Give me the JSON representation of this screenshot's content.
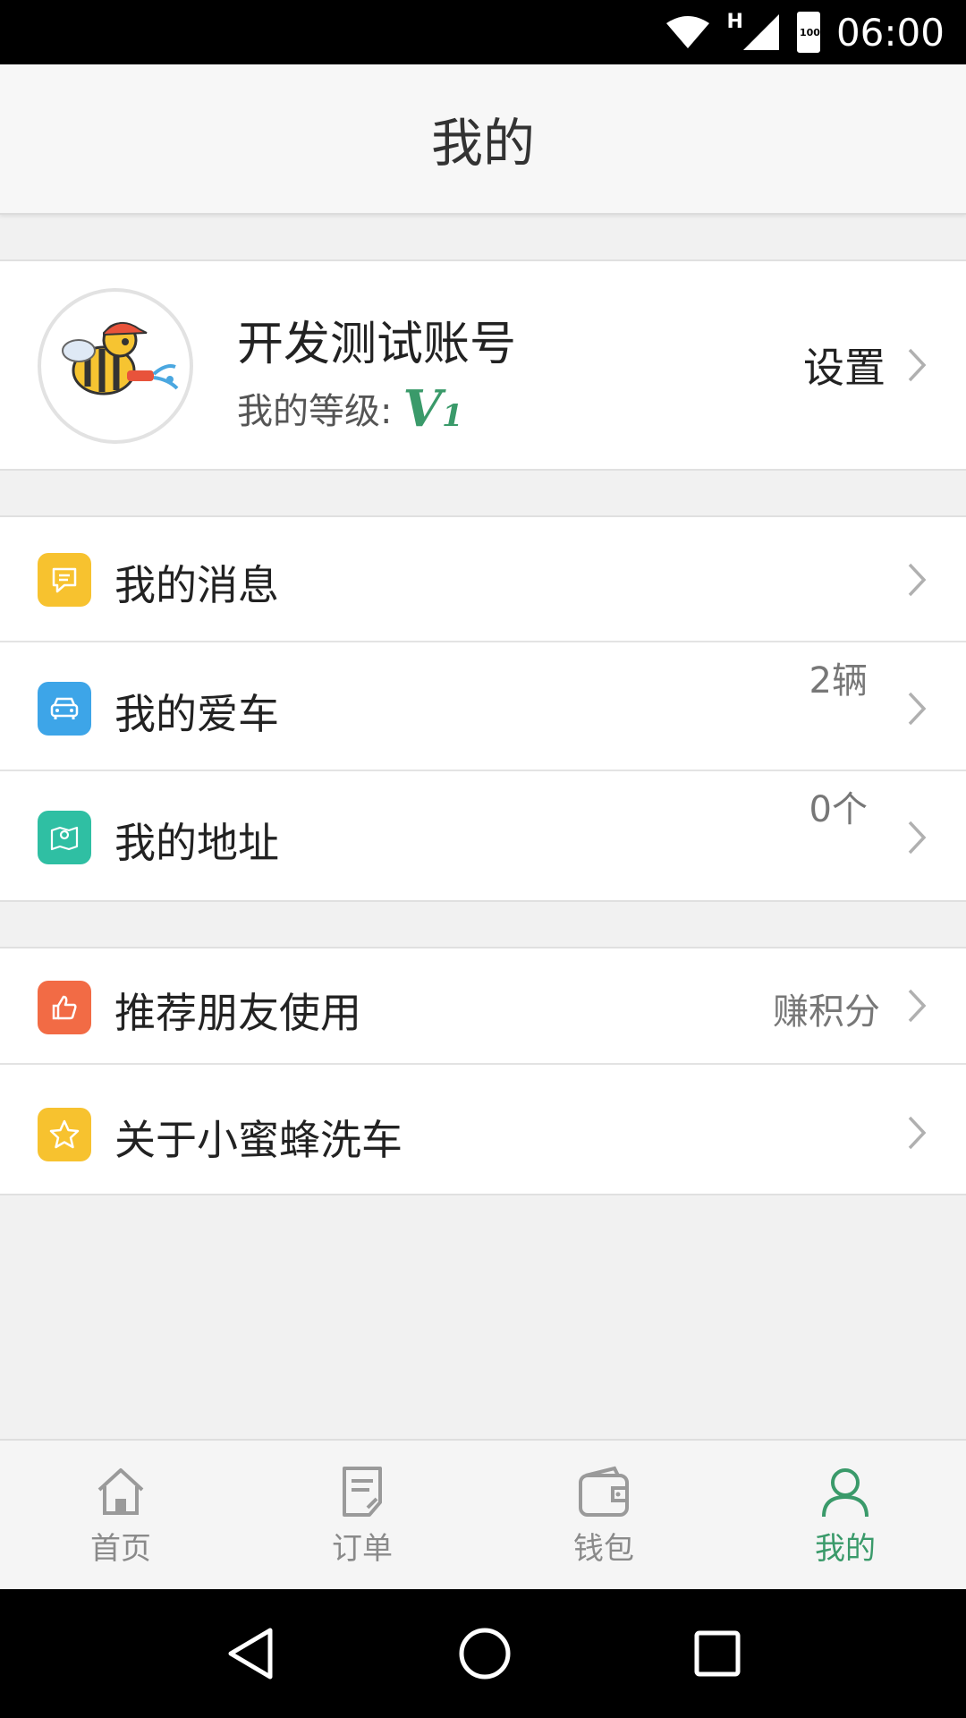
{
  "status_bar": {
    "time": "06:00",
    "battery": "100",
    "network": "H"
  },
  "header": {
    "title": "我的"
  },
  "profile": {
    "username": "开发测试账号",
    "level_label": "我的等级:",
    "level_badge": "V",
    "level_number": "1",
    "settings_label": "设置"
  },
  "menu": {
    "messages": {
      "label": "我的消息",
      "icon_color": "#f7c22f"
    },
    "cars": {
      "label": "我的爱车",
      "value": "2辆",
      "icon_color": "#3da5e8"
    },
    "address": {
      "label": "我的地址",
      "value": "0个",
      "icon_color": "#2fbfa3"
    },
    "recommend": {
      "label": "推荐朋友使用",
      "value": "赚积分",
      "icon_color": "#f26b45"
    },
    "about": {
      "label": "关于小蜜蜂洗车",
      "icon_color": "#f7c22f"
    }
  },
  "tabs": [
    {
      "label": "首页",
      "icon": "home-icon",
      "active": false
    },
    {
      "label": "订单",
      "icon": "order-icon",
      "active": false
    },
    {
      "label": "钱包",
      "icon": "wallet-icon",
      "active": false
    },
    {
      "label": "我的",
      "icon": "user-icon",
      "active": true
    }
  ],
  "colors": {
    "accent": "#3a9a6a",
    "inactive": "#8a8a8a"
  }
}
